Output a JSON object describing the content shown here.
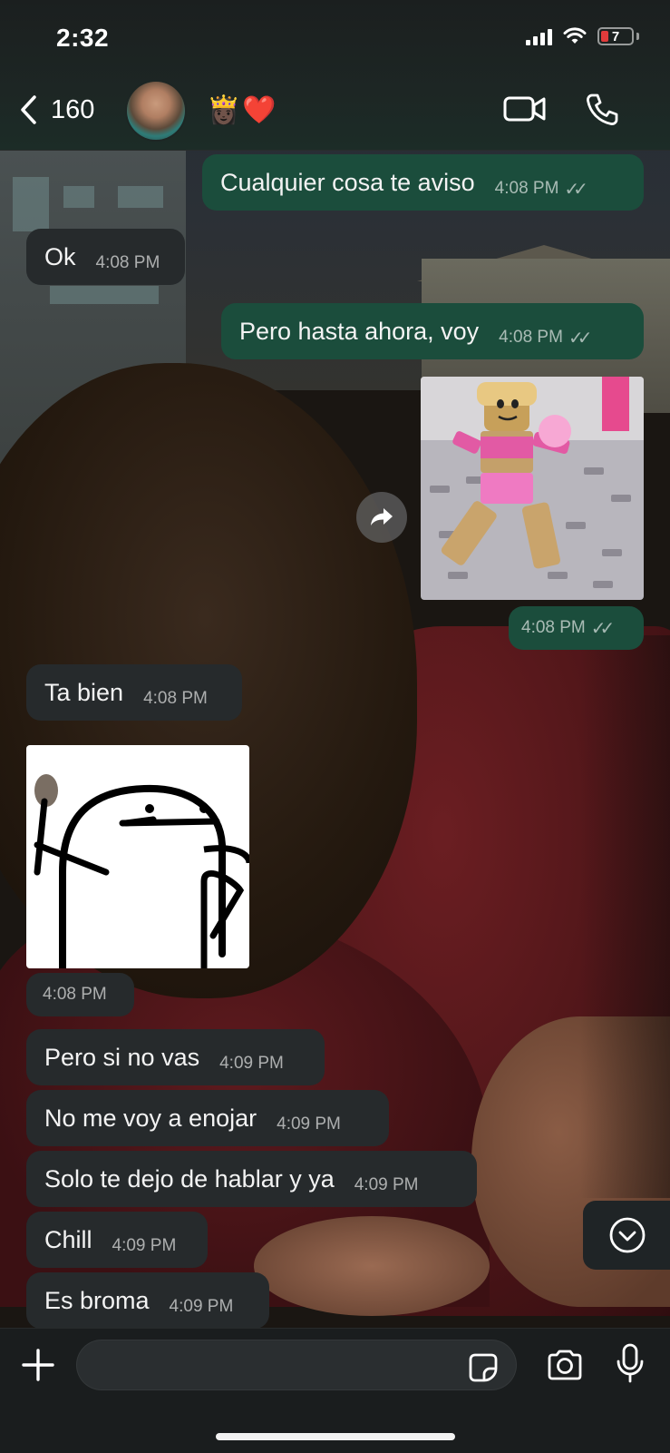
{
  "status_bar": {
    "time": "2:32",
    "battery": "7"
  },
  "header": {
    "back_count": "160",
    "contact_name_emoji": "👸🏿❤️",
    "icons": {
      "back": "chevron-left-icon",
      "video": "video-camera-icon",
      "call": "phone-icon"
    }
  },
  "messages": [
    {
      "direction": "out",
      "text": "Cualquier cosa te aviso",
      "time": "4:08 PM",
      "read": true
    },
    {
      "direction": "in",
      "text": "Ok",
      "time": "4:08 PM"
    },
    {
      "direction": "out",
      "text": "Pero hasta ahora, voy",
      "time": "4:08 PM",
      "read": true
    },
    {
      "direction": "out",
      "type": "image",
      "description": "roblox-character-sticker",
      "time": "4:08 PM",
      "read": true
    },
    {
      "direction": "in",
      "text": "Ta bien",
      "time": "4:08 PM"
    },
    {
      "direction": "in",
      "type": "image",
      "description": "flork-meme-sticker",
      "time": "4:08 PM"
    },
    {
      "direction": "in",
      "text": "Pero si no vas",
      "time": "4:09 PM"
    },
    {
      "direction": "in",
      "text": "No me voy a enojar",
      "time": "4:09 PM"
    },
    {
      "direction": "in",
      "text": "Solo te dejo de hablar y ya",
      "time": "4:09 PM"
    },
    {
      "direction": "in",
      "text": "Chill",
      "time": "4:09 PM"
    },
    {
      "direction": "in",
      "text": "Es broma",
      "time": "4:09 PM"
    }
  ],
  "composer": {
    "placeholder": "",
    "icons": {
      "plus": "plus-icon",
      "sticker": "sticker-icon",
      "camera": "camera-icon",
      "mic": "microphone-icon"
    }
  },
  "colors": {
    "outgoing_bubble": "#1b4d3c",
    "incoming_bubble": "#262a2c",
    "battery_low": "#e03b3b"
  }
}
